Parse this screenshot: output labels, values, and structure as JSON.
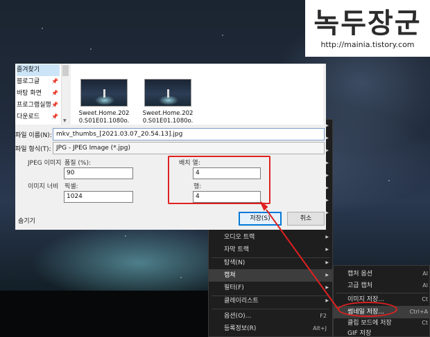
{
  "watermark": {
    "title": "녹두장군",
    "url": "http://mainia.tistory.com"
  },
  "dialog": {
    "nav_items": [
      {
        "label": "즐겨찾기",
        "pinned": false
      },
      {
        "label": "블로그글",
        "pinned": true
      },
      {
        "label": "바탕 화면",
        "pinned": true
      },
      {
        "label": "프로그램실행",
        "pinned": true
      },
      {
        "label": "다운로드",
        "pinned": true
      }
    ],
    "files": [
      {
        "name": "Sweet.Home.2020.S01E01.1080o."
      },
      {
        "name": "Sweet.Home.2020.S01E01.1080o."
      }
    ],
    "filename_label": "파일 이름(N):",
    "filename_value": "mkv_thumbs_[2021.03.07_20.54.13].jpg",
    "filetype_label": "파일 형식(T):",
    "filetype_value": "JPG - JPEG Image (*.jpg)",
    "jpeg_label": "JPEG 이미지",
    "quality_label": "품질 (%):",
    "quality_value": "90",
    "width_label": "이미지 너비",
    "pixel_label": "픽셀:",
    "width_value": "1024",
    "columns_label": "배치 열:",
    "columns_value": "4",
    "rows_label": "행:",
    "rows_value": "4",
    "hide_folders": "숨기기",
    "save_button": "저장(S)",
    "cancel_button": "취소"
  },
  "context_menu": {
    "items": [
      {
        "label": "오디오 트랙",
        "shortcut": "",
        "submenu": true
      },
      {
        "label": "자막 트랙",
        "shortcut": "",
        "submenu": true
      },
      {
        "label": "탐색(N)",
        "shortcut": "",
        "submenu": true
      },
      {
        "label": "캡쳐",
        "shortcut": "",
        "submenu": true,
        "highlighted": true
      },
      {
        "label": "필터(F)",
        "shortcut": "",
        "submenu": true
      },
      {
        "label": "클레이리스트",
        "shortcut": "",
        "submenu": true
      },
      {
        "label": "옵션(O)...",
        "shortcut": "F2",
        "submenu": false
      },
      {
        "label": "등록정보(R)",
        "shortcut": "Alt+J",
        "submenu": false
      }
    ]
  },
  "capture_submenu": {
    "items": [
      {
        "label": "캡처 옵션",
        "shortcut": "Al"
      },
      {
        "label": "고급 캡처",
        "shortcut": "Al"
      },
      {
        "label": "이미지 저장...",
        "shortcut": "Ct"
      },
      {
        "label": "썸네일 저장...",
        "shortcut": "Ctrl+A",
        "highlighted": true
      },
      {
        "label": "클립 보드에 저장",
        "shortcut": "Ct"
      },
      {
        "label": "GIF 저장",
        "shortcut": ""
      }
    ]
  },
  "colors": {
    "annotation": "#e02020",
    "accent": "#0078d7"
  }
}
